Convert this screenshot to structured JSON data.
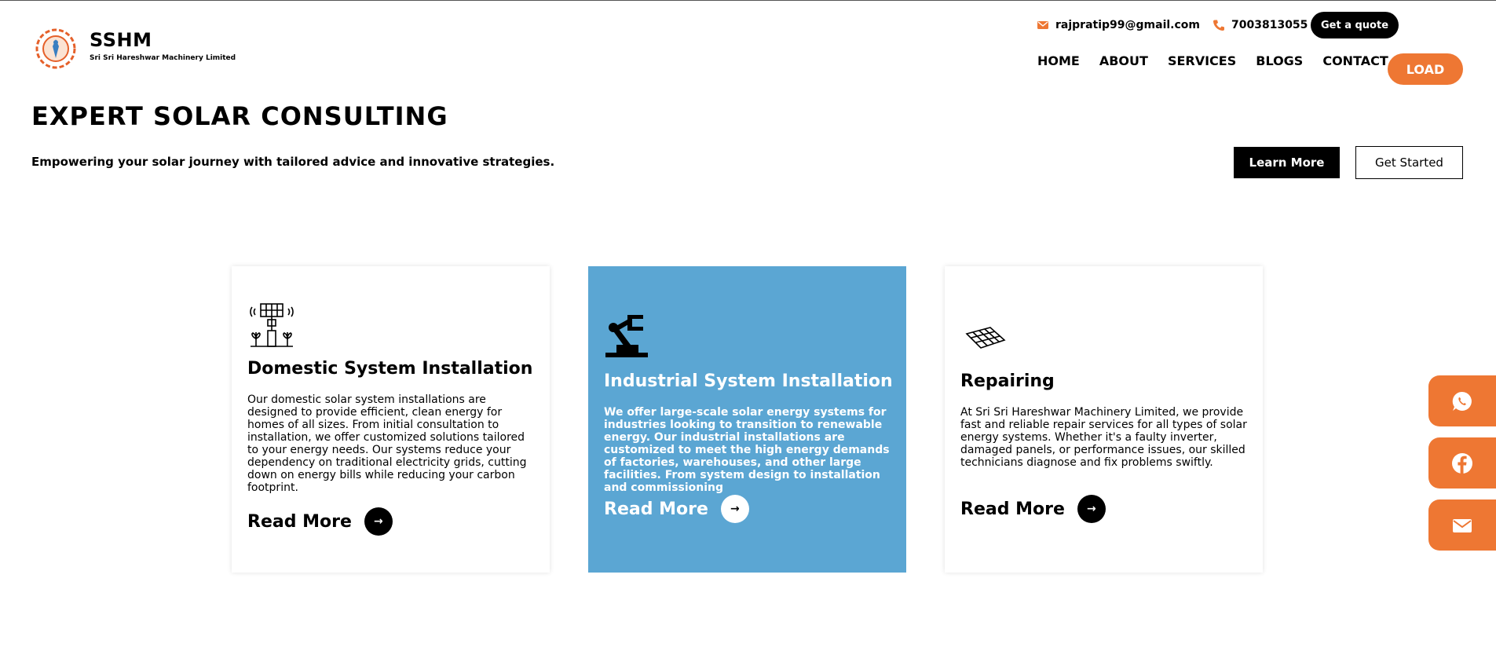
{
  "header": {
    "brand_name": "SSHM",
    "brand_sub": "Sri Sri Hareshwar Machinery Limited",
    "email": "rajpratip99@gmail.com",
    "phone": "7003813055",
    "quote_label": "Get a quote",
    "nav": [
      "HOME",
      "ABOUT",
      "SERVICES",
      "BLOGS",
      "CONTACT"
    ],
    "load_label": "LOAD"
  },
  "hero": {
    "title": "EXPERT SOLAR CONSULTING",
    "subtitle": "Empowering your solar journey with tailored advice and innovative strategies.",
    "learn_more": "Learn More",
    "get_started": "Get Started"
  },
  "cards": [
    {
      "icon": "solar-tree-icon",
      "title": "Domestic System Installation",
      "text": "Our domestic solar system installations are designed to provide efficient, clean energy for homes of all sizes. From initial consultation to installation, we offer customized solutions tailored to your energy needs. Our systems reduce your dependency on traditional electricity grids, cutting down on energy bills while reducing your carbon footprint.",
      "read_more": "Read More"
    },
    {
      "icon": "robot-arm-icon",
      "title": "Industrial System Installation",
      "text": "We offer large-scale solar energy systems for industries looking to transition to renewable energy. Our industrial installations are customized to meet the high energy demands of factories, warehouses, and other large facilities. From system design to installation and commissioning",
      "read_more": "Read More"
    },
    {
      "icon": "solar-panel-icon",
      "title": "Repairing",
      "text": "At Sri Sri Hareshwar Machinery Limited, we provide fast and reliable repair services for all types of solar energy systems. Whether it's a faulty inverter, damaged panels, or performance issues, our skilled technicians diagnose and fix problems swiftly.",
      "read_more": "Read More"
    }
  ],
  "floating": [
    "whatsapp-icon",
    "facebook-icon",
    "mail-icon"
  ],
  "colors": {
    "accent": "#ee7733",
    "card_blue": "#5ba6d3",
    "dark": "#000000"
  }
}
